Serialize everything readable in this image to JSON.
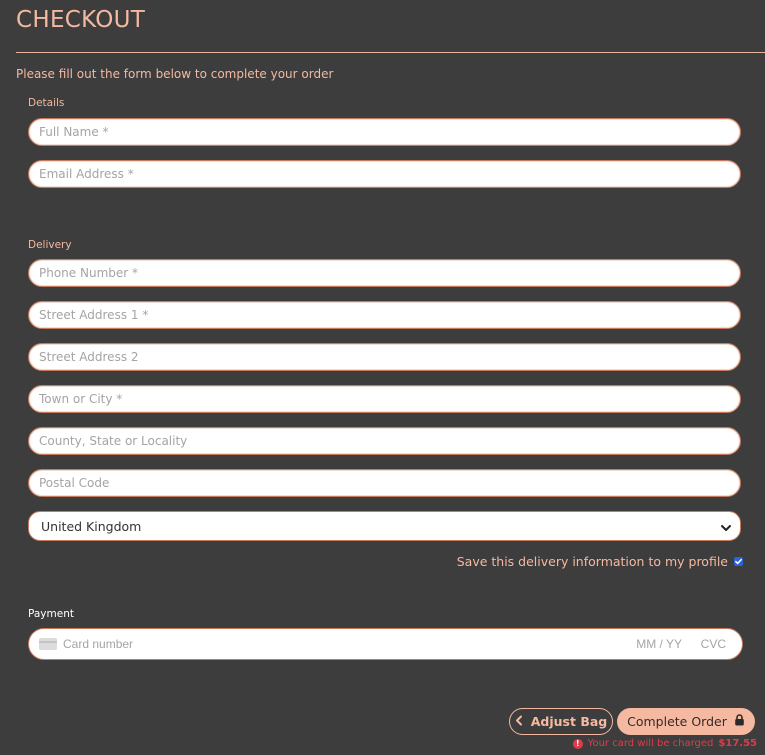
{
  "header": {
    "title": "CHECKOUT",
    "intro": "Please fill out the form below to complete your order"
  },
  "details": {
    "label": "Details",
    "full_name_placeholder": "Full Name *",
    "email_placeholder": "Email Address *"
  },
  "delivery": {
    "label": "Delivery",
    "phone_placeholder": "Phone Number *",
    "street1_placeholder": "Street Address 1 *",
    "street2_placeholder": "Street Address 2",
    "town_placeholder": "Town or City *",
    "county_placeholder": "County, State or Locality",
    "postcode_placeholder": "Postal Code",
    "country_selected": "United Kingdom",
    "save_label": "Save this delivery information to my profile",
    "save_checked": true
  },
  "payment": {
    "label": "Payment",
    "card_placeholder": "Card number",
    "expiry_placeholder": "MM / YY",
    "cvc_placeholder": "CVC"
  },
  "actions": {
    "adjust_bag_label": "Adjust Bag",
    "complete_order_label": "Complete Order",
    "charge_notice": "Your card will be charged",
    "charge_amount": "$17.55"
  },
  "icons": {
    "chevron_left": "chevron-left-icon",
    "lock": "lock-icon",
    "alert": "alert-circle-icon",
    "card": "credit-card-icon",
    "select_chevron": "chevron-down-icon",
    "checkbox": "checkbox-checked-icon"
  },
  "colors": {
    "background": "#3d3d3d",
    "accent": "#f4b9a0",
    "border": "#c87a5c",
    "error": "#e03b4a",
    "checkbox": "#2a64d6"
  }
}
